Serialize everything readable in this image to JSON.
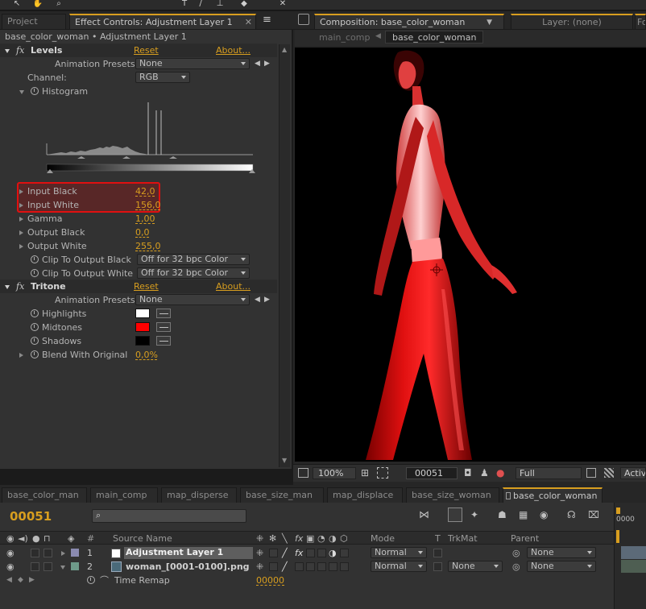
{
  "panels": {
    "project_tab": "Project",
    "effect_controls_tab": "Effect Controls: Adjustment Layer 1",
    "composition_tab": "Composition: base_color_woman",
    "layer_tab": "Layer: (none)",
    "next_tab": "Fo",
    "menu_icon": "≡"
  },
  "effect_controls": {
    "breadcrumb": "base_color_woman • Adjustment Layer 1",
    "levels": {
      "name": "Levels",
      "reset": "Reset",
      "about": "About...",
      "animation_presets_label": "Animation Presets:",
      "animation_presets_value": "None",
      "channel_label": "Channel:",
      "channel_value": "RGB",
      "histogram_label": "Histogram",
      "input_black_label": "Input Black",
      "input_black_value": "42,0",
      "input_white_label": "Input White",
      "input_white_value": "156,0",
      "gamma_label": "Gamma",
      "gamma_value": "1,00",
      "output_black_label": "Output Black",
      "output_black_value": "0,0",
      "output_white_label": "Output White",
      "output_white_value": "255,0",
      "clip_black_label": "Clip To Output Black",
      "clip_black_value": "Off for 32 bpc Color",
      "clip_white_label": "Clip To Output White",
      "clip_white_value": "Off for 32 bpc Color"
    },
    "tritone": {
      "name": "Tritone",
      "reset": "Reset",
      "about": "About...",
      "animation_presets_label": "Animation Presets:",
      "animation_presets_value": "None",
      "highlights_label": "Highlights",
      "highlights_color": "#ffffff",
      "midtones_label": "Midtones",
      "midtones_color": "#ff0000",
      "shadows_label": "Shadows",
      "shadows_color": "#000000",
      "blend_label": "Blend With Original",
      "blend_value": "0,0%"
    }
  },
  "composition": {
    "breadcrumbs": [
      "main_comp",
      "base_color_woman"
    ],
    "zoom": "100%",
    "timecode": "00051",
    "resolution": "Full",
    "active_camera": "Activ"
  },
  "timeline": {
    "tabs": [
      "base_color_man",
      "main_comp",
      "map_disperse",
      "base_size_man",
      "map_displace",
      "base_size_woman",
      "base_color_woman"
    ],
    "active_tab": "base_color_woman",
    "current_time": "00051",
    "ruler_start": "0000",
    "columns": {
      "number": "#",
      "source_name": "Source Name",
      "mode": "Mode",
      "t": "T",
      "trkmat": "TrkMat",
      "parent": "Parent"
    },
    "layers": [
      {
        "number": "1",
        "name": "Adjustment Layer 1",
        "mode": "Normal",
        "trkmat": "",
        "parent": "None"
      },
      {
        "number": "2",
        "name": "woman_[0001-0100].png",
        "mode": "Normal",
        "trkmat": "None",
        "parent": "None"
      }
    ],
    "time_remap_label": "Time Remap",
    "time_remap_value": "00000"
  }
}
